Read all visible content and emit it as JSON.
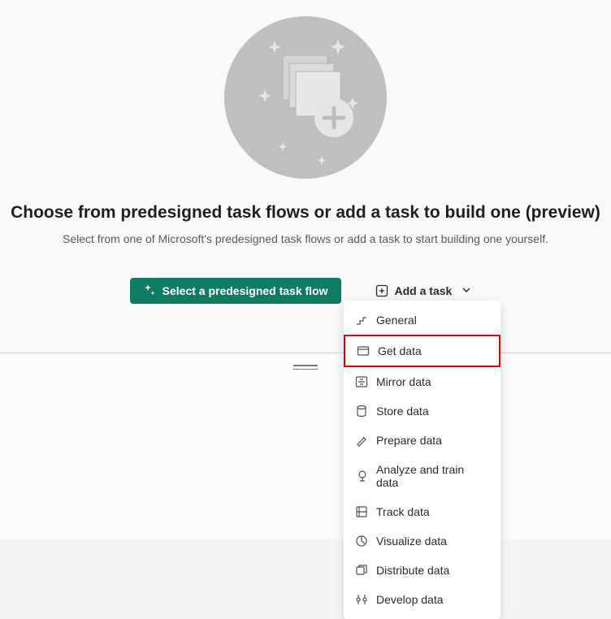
{
  "title": "Choose from predesigned task flows or add a task to build one (preview)",
  "subtitle": "Select from one of Microsoft's predesigned task flows or add a task to start building one yourself.",
  "primaryButton": {
    "label": "Select a predesigned task flow"
  },
  "addTaskButton": {
    "label": "Add a task"
  },
  "dropdown": {
    "items": [
      {
        "label": "General",
        "icon": "step-icon",
        "highlighted": false
      },
      {
        "label": "Get data",
        "icon": "get-data-icon",
        "highlighted": true
      },
      {
        "label": "Mirror data",
        "icon": "mirror-icon",
        "highlighted": false
      },
      {
        "label": "Store data",
        "icon": "store-icon",
        "highlighted": false
      },
      {
        "label": "Prepare data",
        "icon": "prepare-icon",
        "highlighted": false
      },
      {
        "label": "Analyze and train data",
        "icon": "analyze-icon",
        "highlighted": false
      },
      {
        "label": "Track data",
        "icon": "track-icon",
        "highlighted": false
      },
      {
        "label": "Visualize data",
        "icon": "visualize-icon",
        "highlighted": false
      },
      {
        "label": "Distribute data",
        "icon": "distribute-icon",
        "highlighted": false
      },
      {
        "label": "Develop data",
        "icon": "develop-icon",
        "highlighted": false
      }
    ]
  }
}
